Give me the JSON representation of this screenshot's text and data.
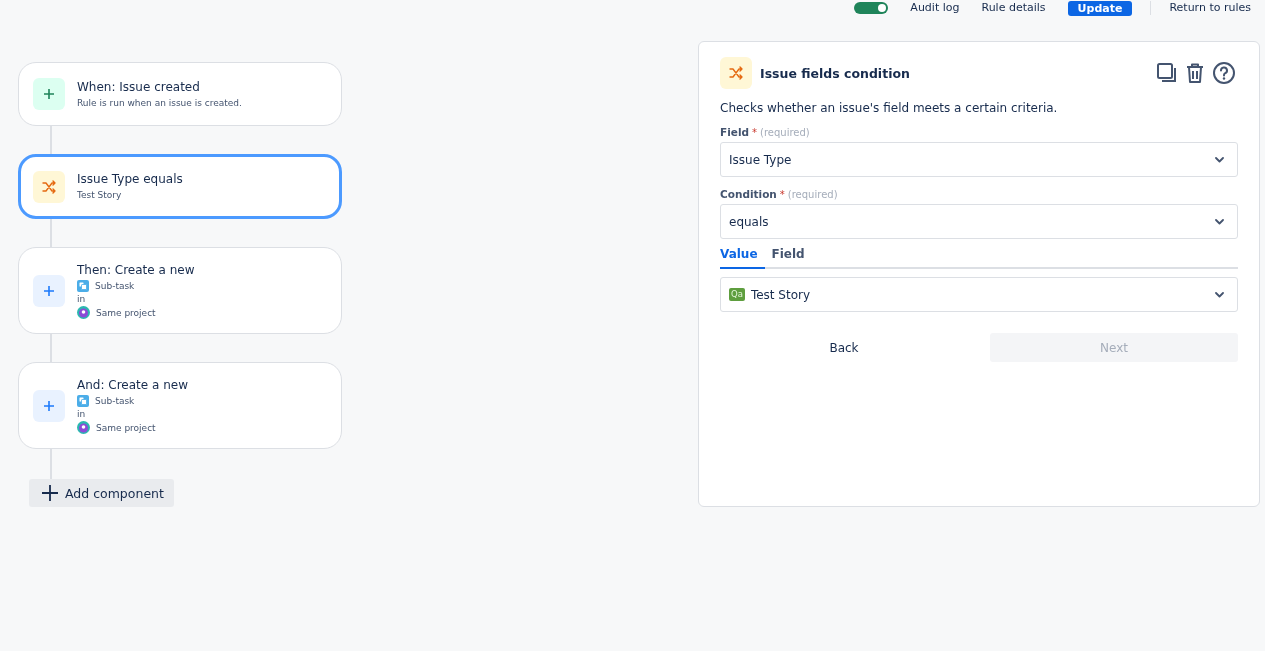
{
  "header": {
    "toggle": {
      "on": true
    },
    "links": [
      "Audit log",
      "Rule details"
    ],
    "primary_button": "Update",
    "return_link": "Return to rules"
  },
  "components": [
    {
      "kind": "trigger",
      "title": "When: Issue created",
      "description": "Rule is run when an issue is created.",
      "selected": false
    },
    {
      "kind": "condition",
      "title": "Issue Type equals",
      "description": "Test Story",
      "selected": true
    },
    {
      "kind": "action",
      "title": "Then: Create a new",
      "issue_type": "Sub-task",
      "connector": "in",
      "project": "Same project",
      "selected": false
    },
    {
      "kind": "action",
      "title": "And: Create a new",
      "issue_type": "Sub-task",
      "connector": "in",
      "project": "Same project",
      "selected": false
    }
  ],
  "add_button": "Add component",
  "panel": {
    "title": "Issue fields condition",
    "description": "Checks whether an issue's field meets a certain criteria.",
    "fields": [
      {
        "label": "Field",
        "required_mark": "*",
        "hint": "(required)",
        "value": "Issue Type"
      },
      {
        "label": "Condition",
        "required_mark": "*",
        "hint": "(required)",
        "value": "equals"
      }
    ],
    "tabs": [
      {
        "label": "Value",
        "selected": true
      },
      {
        "label": "Field",
        "selected": false
      }
    ],
    "value_select": {
      "badge": "Qa",
      "value": "Test Story"
    },
    "buttons": [
      {
        "label": "Back",
        "disabled": false
      },
      {
        "label": "Next",
        "disabled": true
      }
    ]
  }
}
